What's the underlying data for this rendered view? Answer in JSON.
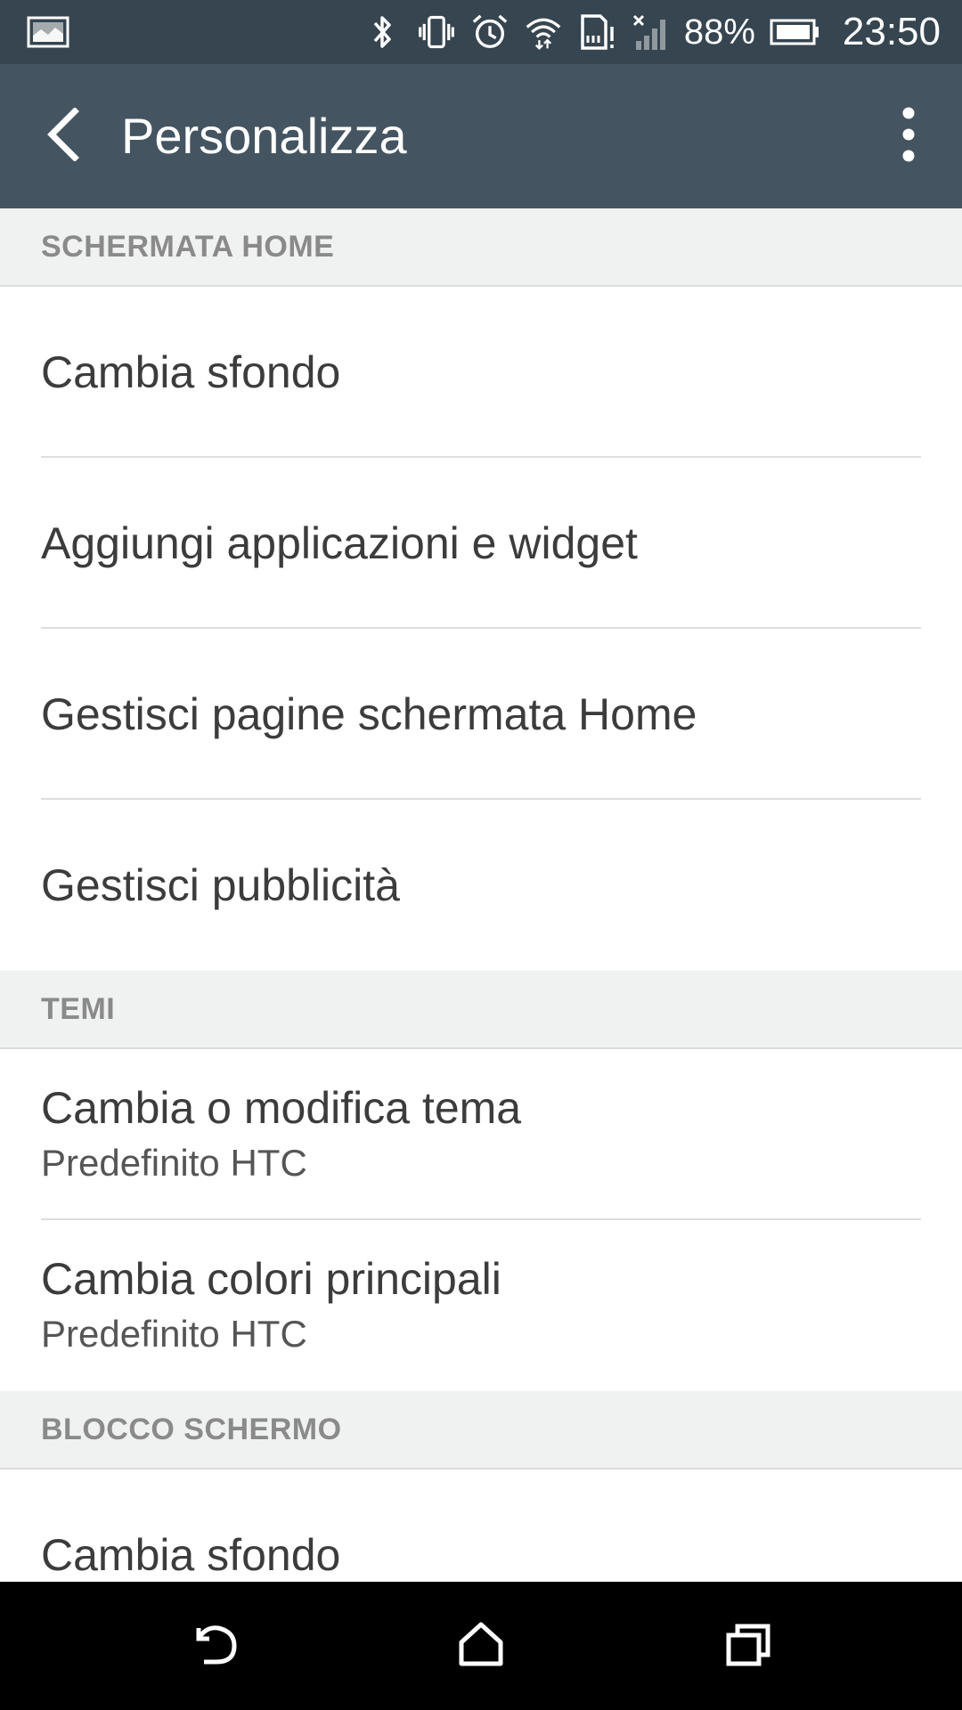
{
  "status_bar": {
    "battery_percent": "88%",
    "time": "23:50",
    "icons": [
      "image-notification-icon",
      "bluetooth-icon",
      "vibrate-icon",
      "alarm-icon",
      "wifi-icon",
      "sd-card-warning-icon",
      "no-signal-icon",
      "battery-icon"
    ]
  },
  "app_bar": {
    "title": "Personalizza",
    "back_icon": "back-arrow-icon",
    "menu_icon": "overflow-menu-icon"
  },
  "sections": [
    {
      "header": "SCHERMATA HOME",
      "items": [
        {
          "title": "Cambia sfondo"
        },
        {
          "title": "Aggiungi applicazioni e widget"
        },
        {
          "title": "Gestisci pagine schermata Home"
        },
        {
          "title": "Gestisci pubblicità"
        }
      ]
    },
    {
      "header": "TEMI",
      "items": [
        {
          "title": "Cambia o modifica tema",
          "subtitle": "Predefinito HTC"
        },
        {
          "title": "Cambia colori principali",
          "subtitle": "Predefinito HTC"
        }
      ]
    },
    {
      "header": "BLOCCO SCHERMO",
      "items": [
        {
          "title": "Cambia sfondo"
        }
      ]
    }
  ],
  "nav_bar": {
    "icons": [
      "back-icon",
      "home-icon",
      "recent-apps-icon"
    ]
  },
  "colors": {
    "status_bar": "#36454f",
    "app_bar": "#445461",
    "section_header_bg": "#f0f1f1",
    "section_header_text": "#8a8a8a",
    "item_text": "#3c3c3c"
  }
}
